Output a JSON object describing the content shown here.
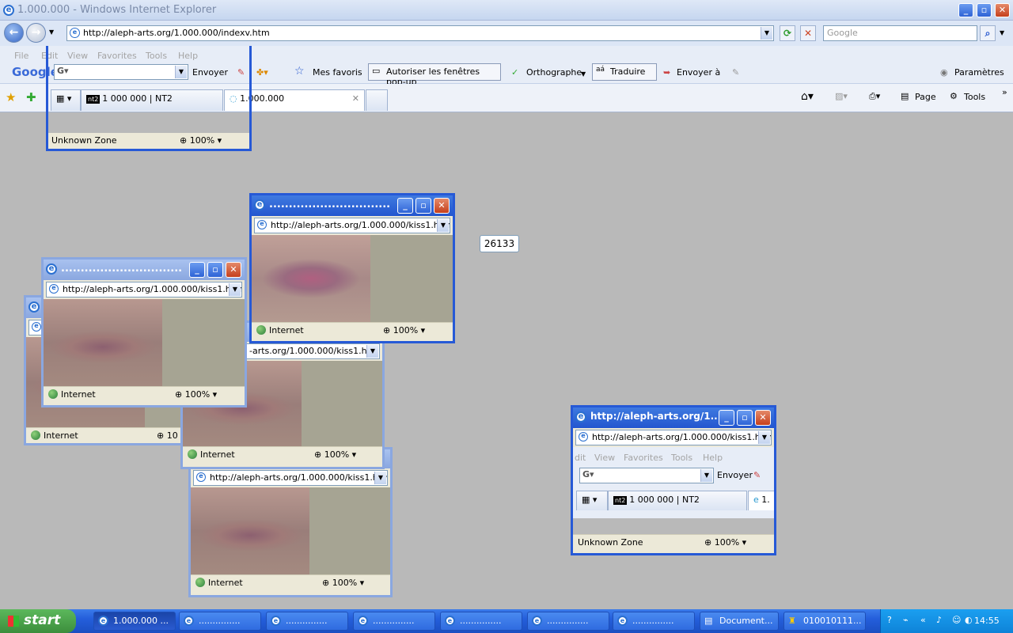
{
  "window": {
    "title": "1.000.000 - Windows Internet Explorer"
  },
  "address": {
    "url": "http://aleph-arts.org/1.000.000/indexv.htm"
  },
  "search": {
    "placeholder": "Google"
  },
  "menu": {
    "items": [
      "File",
      "Edit",
      "View",
      "Favorites",
      "Tools",
      "Help"
    ]
  },
  "googlebar": {
    "logo": "Google",
    "send": "Envoyer",
    "mes_favoris": "Mes favoris",
    "popups": "Autoriser les fenêtres pop-up",
    "spelling": "Orthographe",
    "translate": "Traduire",
    "send_to": "Envoyer à",
    "settings": "Paramètres"
  },
  "tabs": [
    {
      "label": "1 000 000 | NT2"
    },
    {
      "label": "1.000.000"
    }
  ],
  "commandbar": {
    "page": "Page",
    "tools": "Tools"
  },
  "overlay": {
    "zone": "Unknown Zone",
    "zoom": "100%"
  },
  "popups": {
    "title_dots": "...............................",
    "url": "http://aleph-arts.org/1.000.000/kiss1.htm",
    "url_partial": "-arts.org/1.000.000/kiss1.htm",
    "status": "Internet",
    "zoom": "100%",
    "zoom_partial": "10"
  },
  "right_window": {
    "title": "http://aleph-arts.org/1...",
    "url": "http://aleph-arts.org/1.000.000/kiss1.htm",
    "menu": [
      "dit",
      "View",
      "Favorites",
      "Tools",
      "Help"
    ],
    "send": "Envoyer",
    "tab": "1 000 000 | NT2",
    "tab2": "1.",
    "zone": "Unknown Zone",
    "zoom": "100%"
  },
  "counter": "26133",
  "taskbar": {
    "start": "start",
    "items": [
      "1.000.000 ...",
      "...............",
      "...............",
      "...............",
      "...............",
      "...............",
      "...............",
      "Document...",
      "010010111..."
    ],
    "clock": "14:55"
  }
}
